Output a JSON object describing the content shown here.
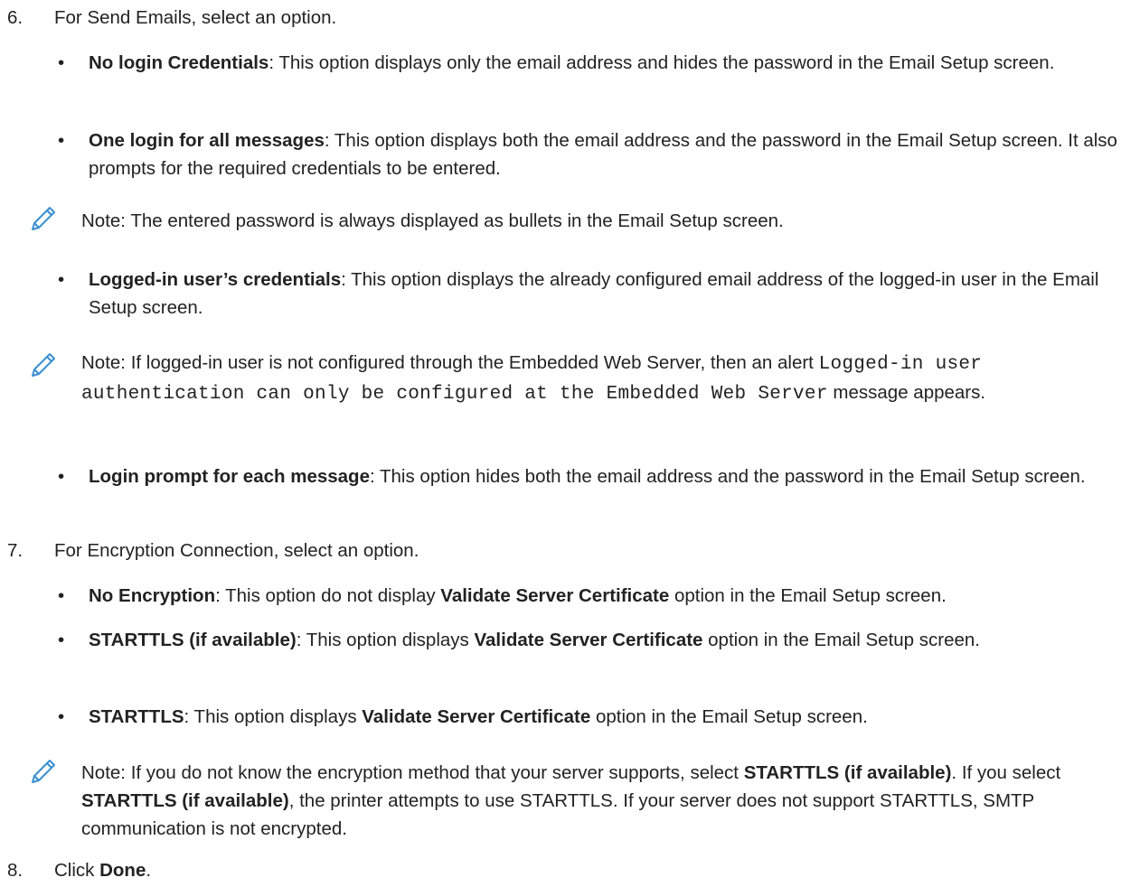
{
  "step6": {
    "number": "6.",
    "text": "For Send Emails, select an option.",
    "b1_title": "No login Credentials",
    "b1_text": ": This option displays only the email address and hides the password in the Email Setup screen.",
    "b2_title": "One login for all messages",
    "b2_text": ": This option displays both the email address and the password in the Email Setup screen. It also prompts for the required credentials to be entered.",
    "note1": "Note: The entered password is always displayed as bullets in the Email Setup screen.",
    "b3_title": "Logged-in user’s credentials",
    "b3_text": ": This option displays the already configured email address of the logged-in user in the Email Setup screen.",
    "note2_pre": "Note: If logged-in user is not configured through the Embedded Web Server, then an alert ",
    "note2_code": "Logged-in user authentication can only be configured at the Embedded Web Server",
    "note2_post": " message appears.",
    "b4_title": "Login prompt for each message",
    "b4_text": ": This option hides both the email address and the password in the Email Setup screen."
  },
  "step7": {
    "number": "7.",
    "text": "For Encryption Connection, select an option.",
    "b1_title": "No Encryption",
    "b1_mid": ": This option do not display ",
    "b1_bold2": "Validate Server Certificate",
    "b1_end": " option in the Email Setup screen.",
    "b2_title": "STARTTLS (if available)",
    "b2_mid": ": This option displays ",
    "b2_bold2": "Validate Server Certificate",
    "b2_end": " option in the Email Setup screen.",
    "b3_title": "STARTTLS",
    "b3_mid": ": This option displays ",
    "b3_bold2": "Validate Server Certificate",
    "b3_end": " option in the Email Setup screen.",
    "note_pre": "Note: If you do not know the encryption method that your server supports, select ",
    "note_bold1": "STARTTLS (if available)",
    "note_mid": ". If you select ",
    "note_bold2": "STARTTLS (if available)",
    "note_end": ", the printer attempts to use STARTTLS. If your server does not support STARTTLS, SMTP communication is not encrypted."
  },
  "step8": {
    "number": "8.",
    "pre": "Click ",
    "bold": "Done",
    "end": "."
  },
  "bullet_char": "•"
}
